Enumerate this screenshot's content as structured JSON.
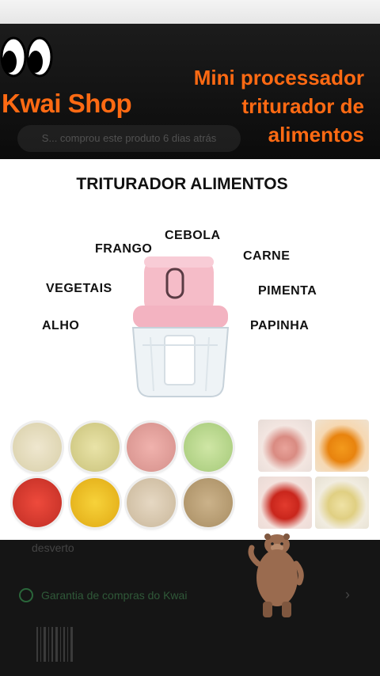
{
  "brand": {
    "name": "Kwai Shop"
  },
  "banner": {
    "headline_lines": [
      "Mini processador",
      "triturador de",
      "alimentos"
    ],
    "ticker": "S... comprou este produto 6 dias atrás"
  },
  "product_image": {
    "title": "TRITURADOR ALIMENTOS",
    "labels": {
      "cebola": "CEBOLA",
      "frango": "FRANGO",
      "carne": "CARNE",
      "vegetais": "VEGETAIS",
      "pimenta": "PIMENTA",
      "alho": "ALHO",
      "papinha": "PAPINHA"
    }
  },
  "below": {
    "partial_text": "desverto",
    "guarantee": "Garantia de compras do Kwai"
  },
  "colors": {
    "accent": "#ff6a13",
    "background": "#141414",
    "card": "#ffffff"
  },
  "icons": [
    "cartoon-eyes-icon",
    "check-circle-icon",
    "chevron-right-icon",
    "bear-sticker-icon",
    "barcode-icon"
  ]
}
